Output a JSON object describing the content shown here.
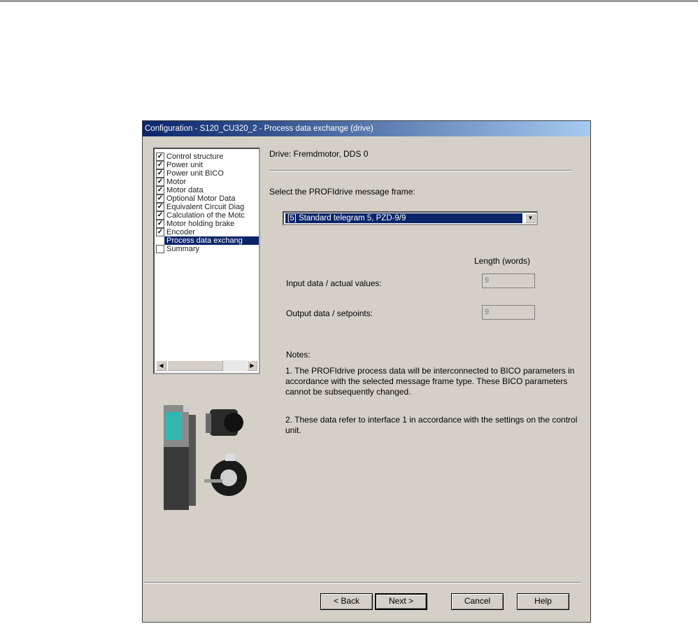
{
  "window": {
    "title": "Configuration - S120_CU320_2 - Process data exchange (drive)"
  },
  "tree": {
    "items": [
      {
        "label": "Control structure",
        "checked": true
      },
      {
        "label": "Power unit",
        "checked": true
      },
      {
        "label": "Power unit BICO",
        "checked": true
      },
      {
        "label": "Motor",
        "checked": true
      },
      {
        "label": "Motor data",
        "checked": true
      },
      {
        "label": "Optional Motor Data",
        "checked": true
      },
      {
        "label": "Equivalent Circuit Diag",
        "checked": true
      },
      {
        "label": "Calculation of the Motc",
        "checked": true
      },
      {
        "label": "Motor holding brake",
        "checked": true
      },
      {
        "label": "Encoder",
        "checked": true
      },
      {
        "label": "Process data exchang",
        "checked": false,
        "selected": true
      },
      {
        "label": "Summary",
        "checked": false
      }
    ]
  },
  "main": {
    "drive_label": "Drive: Fremdmotor, DDS 0",
    "select_prompt": "Select the PROFIdrive message frame:",
    "message_frame": "[5] Standard telegram 5, PZD-9/9",
    "length_header": "Length (words)",
    "input_label": "Input data / actual values:",
    "input_value": "9",
    "output_label": "Output data / setpoints:",
    "output_value": "9",
    "notes_title": "Notes:",
    "note1": "1. The PROFIdrive process data will be interconnected to BICO parameters in accordance with the selected message frame type. These BICO parameters cannot be subsequently changed.",
    "note2": "2. These data refer to interface 1 in accordance with the settings on the control unit."
  },
  "buttons": {
    "back": "< Back",
    "next": "Next >",
    "cancel": "Cancel",
    "help": "Help"
  }
}
